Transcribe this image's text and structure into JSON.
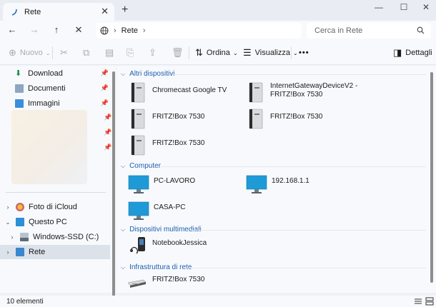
{
  "window": {
    "tab_title": "Rete",
    "tab_close": "✕",
    "new_tab": "+",
    "minimize": "—",
    "maximize": "☐",
    "close": "✕"
  },
  "address": {
    "breadcrumb": "Rete",
    "search_placeholder": "Cerca in Rete"
  },
  "command_bar": {
    "new_label": "Nuovo",
    "sort_label": "Ordina",
    "view_label": "Visualizza",
    "more_label": "•••",
    "details_label": "Dettagli"
  },
  "sidebar": {
    "quick_access": [
      {
        "label": "Download"
      },
      {
        "label": "Documenti"
      },
      {
        "label": "Immagini"
      }
    ],
    "icloud": "Foto di iCloud",
    "this_pc": "Questo PC",
    "drive": "Windows-SSD (C:)",
    "network": "Rete"
  },
  "main": {
    "groups": {
      "other_devices": "Altri dispositivi",
      "computer": "Computer",
      "multimedia": "Dispositivi multimediali",
      "infrastructure": "Infrastruttura di rete"
    },
    "other_devices": [
      {
        "label": "Chromecast Google TV"
      },
      {
        "label": "InternetGatewayDeviceV2 -"
      },
      {
        "label": "FRITZ!Box 7530"
      },
      {
        "label": "FRITZ!Box 7530"
      },
      {
        "label": "FRITZ!Box 7530"
      },
      {
        "label": "FRITZ!Box 7530"
      }
    ],
    "computers": [
      {
        "label": "PC-LAVORO"
      },
      {
        "label": "192.168.1.1"
      },
      {
        "label": "CASA-PC"
      }
    ],
    "multimedia": [
      {
        "label": "NotebookJessica"
      }
    ],
    "infrastructure": [
      {
        "label": "FRITZ!Box 7530"
      }
    ]
  },
  "status": {
    "count": "10 elementi"
  },
  "colors": {
    "accent": "#1f5fae",
    "monitor_blue": "#1e9bd7"
  }
}
